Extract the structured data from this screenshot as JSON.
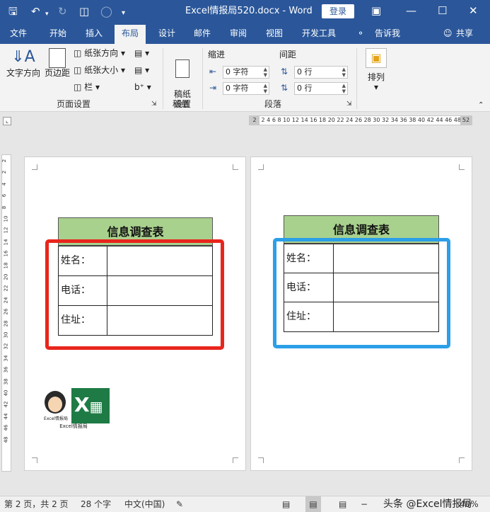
{
  "titlebar": {
    "title": "Excel情报局520.docx - Word",
    "login": "登录"
  },
  "menu": {
    "tabs": [
      "文件",
      "开始",
      "插入",
      "布局",
      "设计",
      "邮件",
      "审阅",
      "视图",
      "开发工具"
    ],
    "tell": "告诉我",
    "share": "共享"
  },
  "ribbon": {
    "text_direction": "文字方向",
    "margins": "页边距",
    "orientation": "纸张方向",
    "size": "纸张大小",
    "columns": "栏",
    "page_setup_group": "页面设置",
    "draft_paper": "稿纸\n设置",
    "draft_group": "稿纸",
    "indent_label": "缩进",
    "spacing_label": "间距",
    "indent_left": "0 字符",
    "indent_right": "0 字符",
    "spacing_before": "0 行",
    "spacing_after": "0 行",
    "paragraph_group": "段落",
    "arrange": "排列"
  },
  "ruler": {
    "h_start": "2",
    "h_end": "52",
    "h_ticks": "2 4 6 8 10 12 14 16 18 20 22 24 26 28 30 32 34 36 38 40 42 44 46 48",
    "v_ticks": [
      "2",
      "2",
      "4",
      "6",
      "8",
      "10",
      "12",
      "14",
      "16",
      "18",
      "20",
      "22",
      "24",
      "26",
      "28",
      "30",
      "32",
      "34",
      "36",
      "38",
      "40",
      "42",
      "44",
      "46",
      "48"
    ]
  },
  "page1": {
    "table_title": "信息调查表",
    "rows": [
      "姓名：",
      "电话：",
      "住址："
    ],
    "logo_text1": "Excel情报局",
    "logo_text2": "Excel情报局"
  },
  "page2": {
    "table_title": "信息调查表",
    "rows": [
      "姓名：",
      "电话：",
      "住址："
    ]
  },
  "status": {
    "page": "第 2 页，共 2 页",
    "words": "28 个字",
    "lang": "中文(中国)",
    "watermark": "头条 @Excel情报局",
    "zoom": "40%"
  },
  "colors": {
    "title_bg": "#2b579a",
    "header_fill": "#a9d18e",
    "red_frame": "#e8261c",
    "blue_frame": "#2b9fe8"
  }
}
